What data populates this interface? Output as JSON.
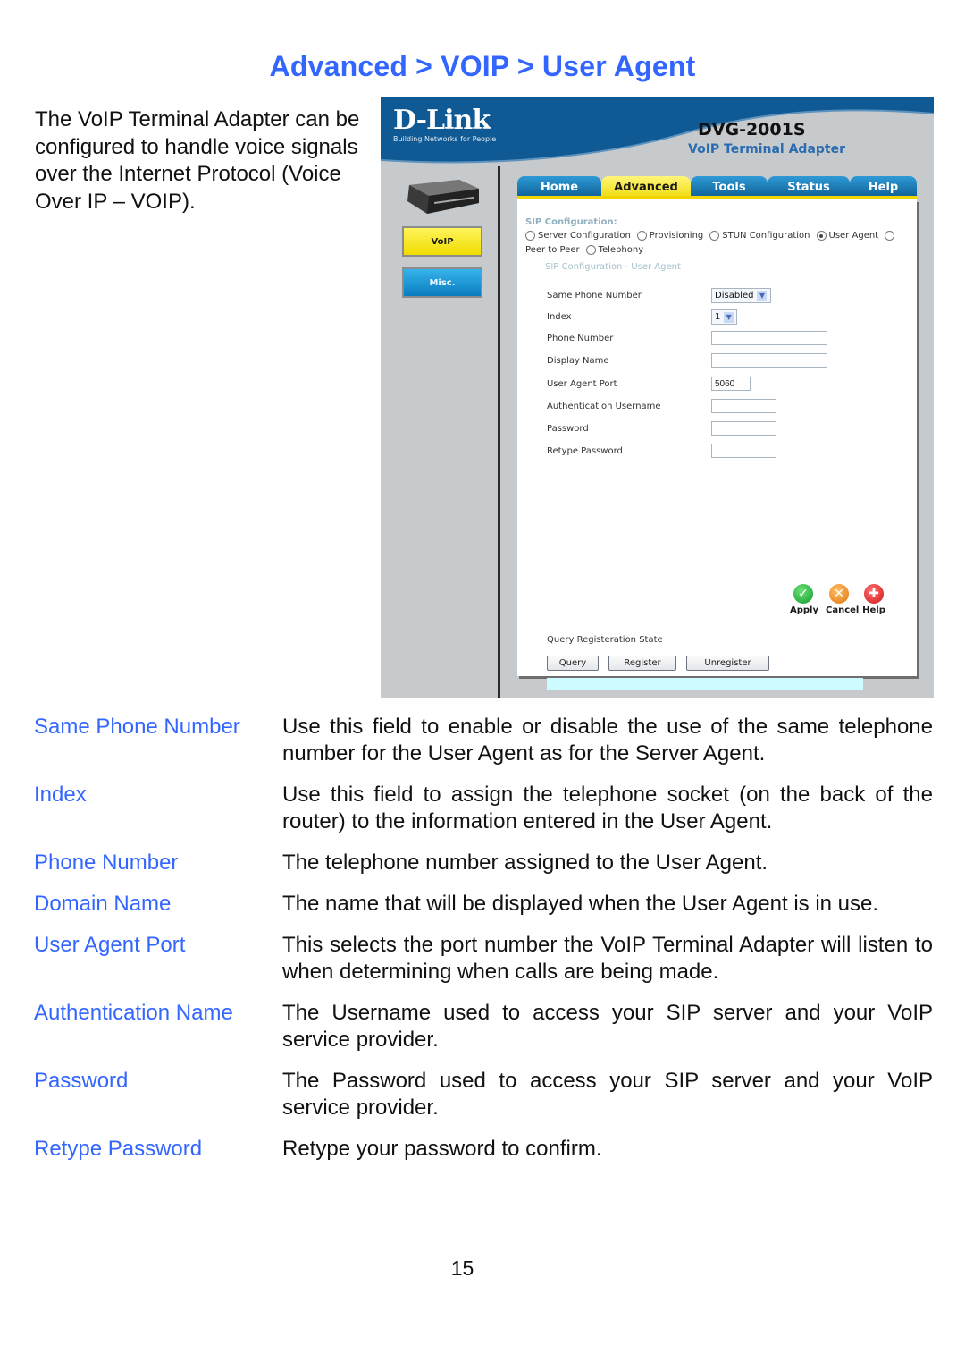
{
  "page_title": "Advanced > VOIP > User Agent",
  "intro": "The VoIP Terminal Adapter can be configured to handle voice signals over the Internet Protocol (Voice Over IP – VOIP).",
  "screenshot": {
    "brand": {
      "logo": "D-Link",
      "tagline": "Building Networks for People",
      "model": "DVG-2001S",
      "model_subtitle": "VoIP Terminal Adapter",
      "colors": {
        "header_blue": "#0f5a94",
        "active_yellow": "#f1dc10",
        "tab_blue": "#1a7ab8"
      }
    },
    "side_menu": [
      {
        "label": "VoIP",
        "active": true
      },
      {
        "label": "Misc.",
        "active": false
      }
    ],
    "tabs": [
      {
        "label": "Home",
        "active": false
      },
      {
        "label": "Advanced",
        "active": true
      },
      {
        "label": "Tools",
        "active": false
      },
      {
        "label": "Status",
        "active": false
      },
      {
        "label": "Help",
        "active": false
      }
    ],
    "sip_heading": "SIP Configuration:",
    "sip_options": [
      {
        "label": "Server Configuration",
        "checked": false
      },
      {
        "label": "Provisioning",
        "checked": false
      },
      {
        "label": "STUN Configuration",
        "checked": false
      },
      {
        "label": "User Agent",
        "checked": true
      },
      {
        "label": "Peer to Peer",
        "checked": false
      },
      {
        "label": "Telephony",
        "checked": false
      }
    ],
    "section_heading": "SIP Configuration - User Agent",
    "fields": {
      "same_phone_number": {
        "label": "Same Phone Number",
        "value": "Disabled"
      },
      "index": {
        "label": "Index",
        "value": "1"
      },
      "phone_number": {
        "label": "Phone Number",
        "value": ""
      },
      "display_name": {
        "label": "Display Name",
        "value": ""
      },
      "user_agent_port": {
        "label": "User Agent Port",
        "value": "5060"
      },
      "auth_username": {
        "label": "Authentication Username",
        "value": ""
      },
      "password": {
        "label": "Password",
        "value": ""
      },
      "retype_password": {
        "label": "Retype Password",
        "value": ""
      }
    },
    "actions": {
      "apply": "Apply",
      "cancel": "Cancel",
      "help": "Help"
    },
    "query": {
      "label": "Query Registeration State",
      "buttons": {
        "query": "Query",
        "register": "Register",
        "unregister": "Unregister"
      },
      "status_text": ""
    }
  },
  "definitions": [
    {
      "term": "Same Phone Number",
      "description": "Use this field to enable or disable the use of the same telephone number for the User Agent as for the Server Agent."
    },
    {
      "term": "Index",
      "description": "Use this field to assign the telephone socket (on the back of the router) to the information entered in the User Agent."
    },
    {
      "term": "Phone Number",
      "description": "The telephone number assigned to the User Agent."
    },
    {
      "term": "Domain Name",
      "description": "The name that will be displayed when the User Agent is in use."
    },
    {
      "term": "User Agent Port",
      "description": "This selects the port number the VoIP Terminal Adapter will listen to when determining when calls are being made."
    },
    {
      "term": "Authentication Name",
      "description": "The Username used to access your SIP server and your VoIP service provider."
    },
    {
      "term": "Password",
      "description": "The Password used to access your SIP server and your VoIP service provider."
    },
    {
      "term": "Retype Password",
      "description": "Retype your password to confirm."
    }
  ],
  "page_number": "15"
}
